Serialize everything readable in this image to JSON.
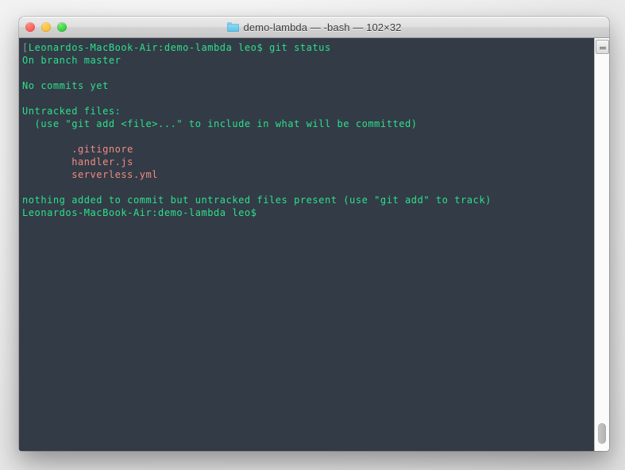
{
  "window": {
    "title": "demo-lambda — -bash — 102×32",
    "folder_icon": "folder-icon",
    "traffic_lights": {
      "close_label": "close",
      "minimize_label": "minimize",
      "zoom_label": "zoom",
      "close_color": "#fc5753",
      "minimize_color": "#fdbc2f",
      "zoom_color": "#2ccf33"
    }
  },
  "terminal": {
    "background_color": "#333b47",
    "text_color": "#2de08a",
    "untracked_color": "#f28b82",
    "bracket_color": "#8b94a3",
    "columns": 102,
    "rows": 32,
    "lines": [
      {
        "id": "prompt-command",
        "bracket": "[",
        "text": "Leonardos-MacBook-Air:demo-lambda leo$ git status",
        "style": "normal"
      },
      {
        "id": "branch",
        "text": "On branch master",
        "style": "normal"
      },
      {
        "id": "blank-1",
        "text": "",
        "style": "blank"
      },
      {
        "id": "no-commits",
        "text": "No commits yet",
        "style": "normal"
      },
      {
        "id": "blank-2",
        "text": "",
        "style": "blank"
      },
      {
        "id": "untracked-heading",
        "text": "Untracked files:",
        "style": "normal"
      },
      {
        "id": "untracked-hint",
        "text": "  (use \"git add <file>...\" to include in what will be committed)",
        "style": "normal"
      },
      {
        "id": "blank-3",
        "text": "",
        "style": "blank"
      },
      {
        "id": "file-gitignore",
        "text": "        .gitignore",
        "style": "untracked"
      },
      {
        "id": "file-handler",
        "text": "        handler.js",
        "style": "untracked"
      },
      {
        "id": "file-serverless",
        "text": "        serverless.yml",
        "style": "untracked"
      },
      {
        "id": "blank-4",
        "text": "",
        "style": "blank"
      },
      {
        "id": "summary",
        "text": "nothing added to commit but untracked files present (use \"git add\" to track)",
        "style": "normal"
      },
      {
        "id": "prompt-idle",
        "text": "Leonardos-MacBook-Air:demo-lambda leo$",
        "style": "normal"
      }
    ]
  },
  "scrollbar": {
    "split_button_icon": "split-pane-icon"
  }
}
